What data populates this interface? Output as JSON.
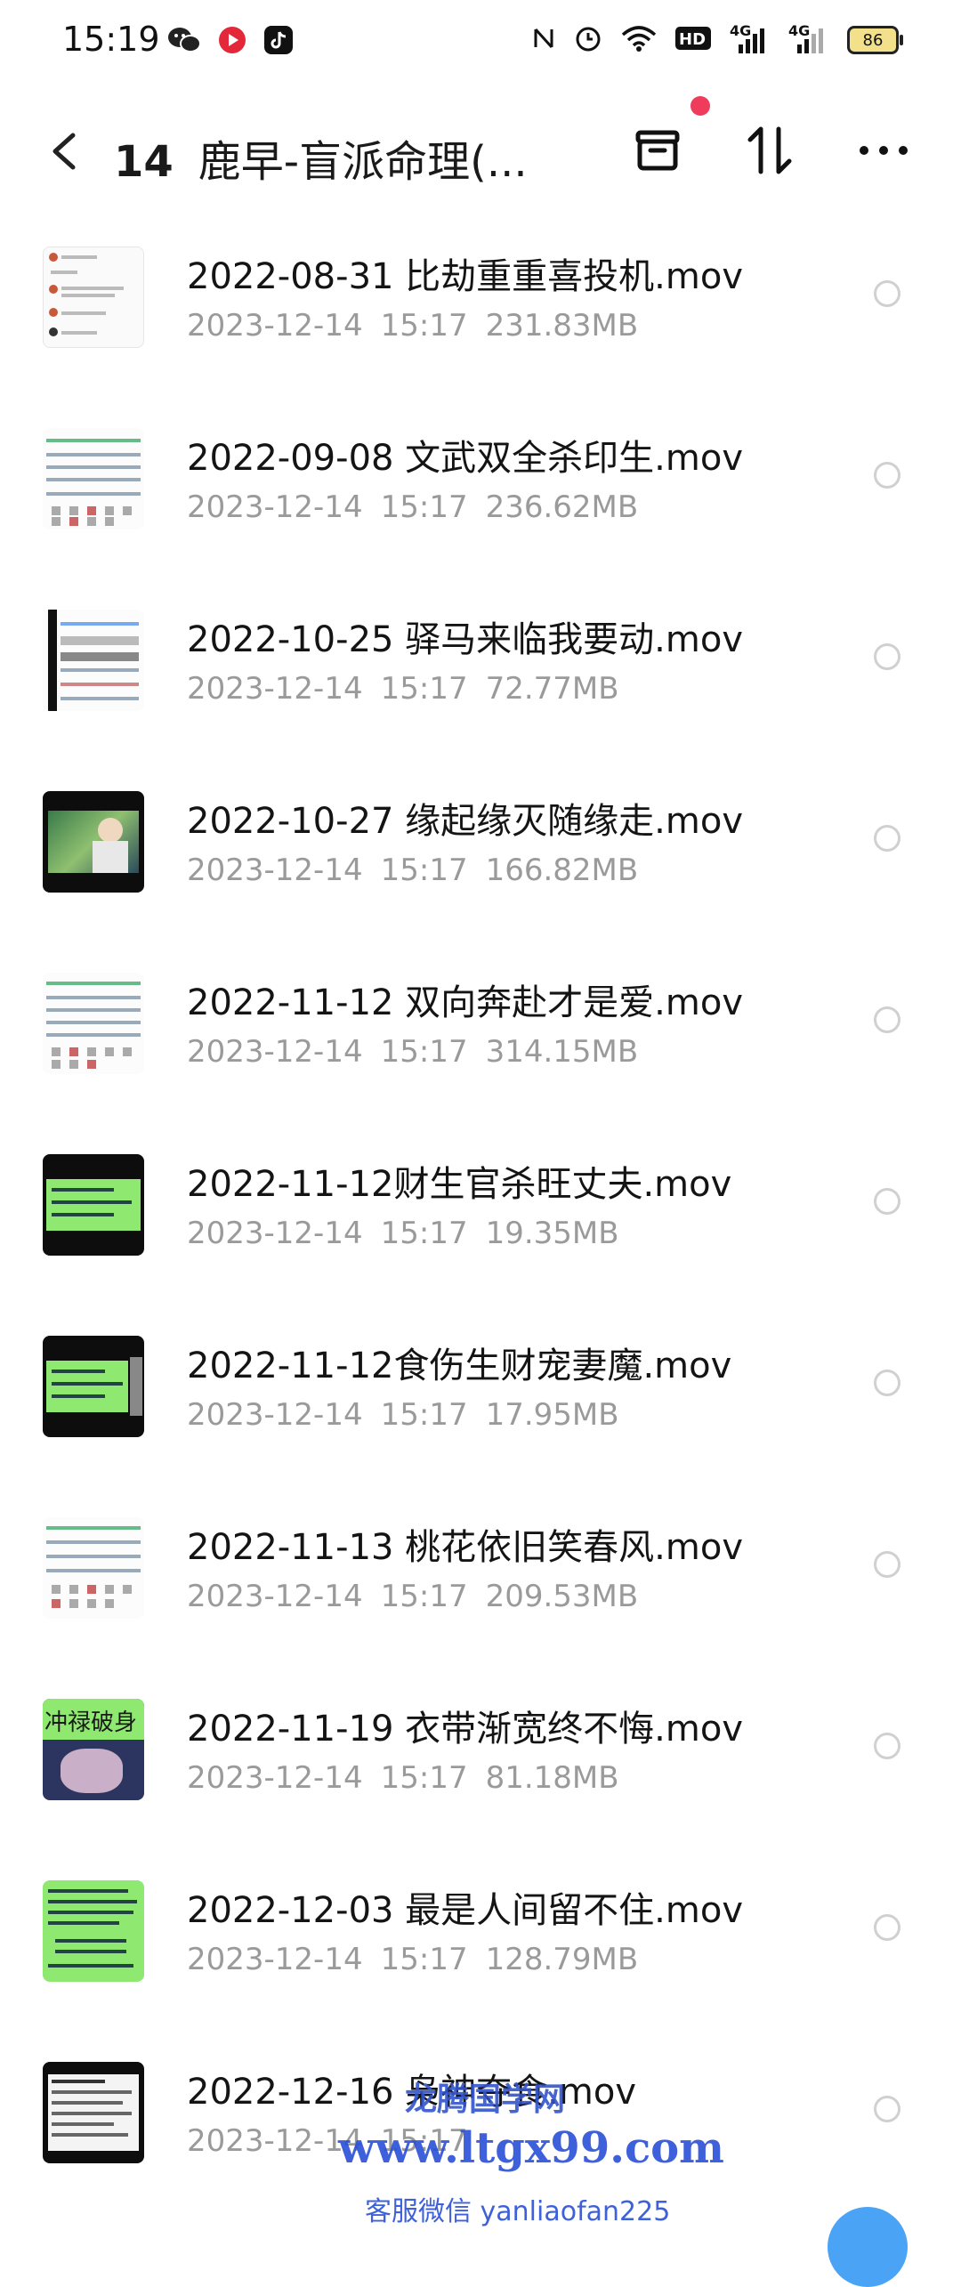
{
  "status_bar": {
    "time": "15:19",
    "apps": [
      "wechat-icon",
      "video-app-icon",
      "tiktok-icon"
    ],
    "indicators": [
      "nfc-icon",
      "alarm-icon",
      "wifi-icon",
      "hd-icon",
      "signal-4g-icon",
      "signal-4g-icon"
    ],
    "hd_label": "HD",
    "net_label_1": "4G",
    "net_label_2": "4G",
    "battery": "86"
  },
  "header": {
    "count": "14",
    "title": "鹿早-盲派命理(...",
    "accent_dot_color": "#ef3b5c"
  },
  "files": [
    {
      "name": "2022-08-31 比劫重重喜投机.mov",
      "date": "2023-12-14",
      "time": "15:17",
      "size": "231.83MB",
      "thumb": "chat"
    },
    {
      "name": "2022-09-08 文武双全杀印生.mov",
      "date": "2023-12-14",
      "time": "15:17",
      "size": "236.62MB",
      "thumb": "table"
    },
    {
      "name": "2022-10-25 驿马来临我要动.mov",
      "date": "2023-12-14",
      "time": "15:17",
      "size": "72.77MB",
      "thumb": "table-dark"
    },
    {
      "name": "2022-10-27 缘起缘灭随缘走.mov",
      "date": "2023-12-14",
      "time": "15:17",
      "size": "166.82MB",
      "thumb": "photo"
    },
    {
      "name": "2022-11-12 双向奔赴才是爱.mov",
      "date": "2023-12-14",
      "time": "15:17",
      "size": "314.15MB",
      "thumb": "table"
    },
    {
      "name": "2022-11-12财生官杀旺丈夫.mov",
      "date": "2023-12-14",
      "time": "15:17",
      "size": "19.35MB",
      "thumb": "green-panel"
    },
    {
      "name": "2022-11-12食伤生财宠妻魔.mov",
      "date": "2023-12-14",
      "time": "15:17",
      "size": "17.95MB",
      "thumb": "green-panel"
    },
    {
      "name": "2022-11-13 桃花依旧笑春风.mov",
      "date": "2023-12-14",
      "time": "15:17",
      "size": "209.53MB",
      "thumb": "table"
    },
    {
      "name": "2022-11-19 衣带渐宽终不悔.mov",
      "date": "2023-12-14",
      "time": "15:17",
      "size": "81.18MB",
      "thumb": "green-title"
    },
    {
      "name": "2022-12-03 最是人间留不住.mov",
      "date": "2023-12-14",
      "time": "15:17",
      "size": "128.79MB",
      "thumb": "green-text"
    },
    {
      "name": "2022-12-16 枭神夺食.mov",
      "date": "2023-12-14",
      "time": "15:17",
      "size": "",
      "thumb": "doc"
    }
  ],
  "thumb_texts": {
    "green_title": "冲禄破身"
  },
  "watermark": {
    "line1": "龙腾国学网",
    "line2": "www.ltgx99.com",
    "line3": "客服微信 yanliaofan225"
  }
}
